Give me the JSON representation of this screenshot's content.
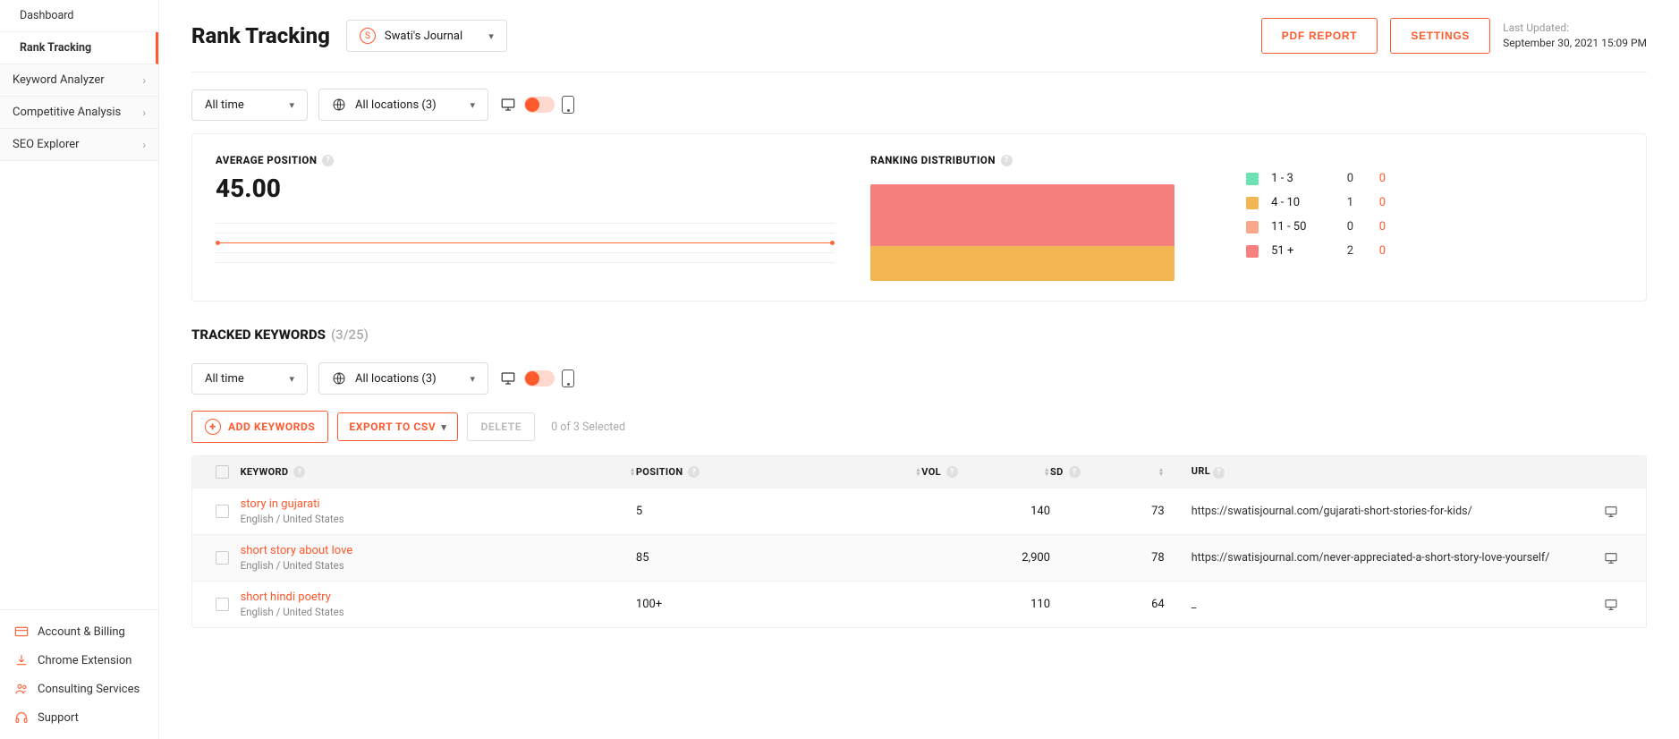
{
  "sidebar": {
    "dashboard": "Dashboard",
    "rankTracking": "Rank Tracking",
    "keywordAnalyzer": "Keyword Analyzer",
    "competitiveAnalysis": "Competitive Analysis",
    "seoExplorer": "SEO Explorer"
  },
  "sidebarBottom": {
    "accountBilling": "Account & Billing",
    "chromeExtension": "Chrome Extension",
    "consultingServices": "Consulting Services",
    "support": "Support"
  },
  "header": {
    "title": "Rank Tracking",
    "accountAvatar": "S",
    "accountName": "Swati's Journal",
    "pdfReport": "PDF REPORT",
    "settings": "SETTINGS",
    "lastUpdatedLabel": "Last Updated:",
    "lastUpdatedValue": "September 30, 2021 15:09 PM"
  },
  "filters": {
    "timeRange": "All time",
    "locations": "All locations (3)"
  },
  "avgPosition": {
    "label": "AVERAGE POSITION",
    "value": "45.00"
  },
  "rankingDistribution": {
    "label": "RANKING DISTRIBUTION",
    "legend": [
      {
        "range": "1 - 3",
        "col1": "0",
        "col2": "0",
        "color": "#6de2b5"
      },
      {
        "range": "4 - 10",
        "col1": "1",
        "col2": "0",
        "color": "#f2b752"
      },
      {
        "range": "11 - 50",
        "col1": "0",
        "col2": "0",
        "color": "#f9a98a"
      },
      {
        "range": "51 +",
        "col1": "2",
        "col2": "0",
        "color": "#f5807e"
      }
    ]
  },
  "trackedKeywords": {
    "label": "TRACKED KEYWORDS",
    "count": "(3/25)"
  },
  "actions": {
    "addKeywords": "ADD KEYWORDS",
    "exportCsv": "EXPORT TO CSV",
    "delete": "DELETE",
    "selectedText": "0 of 3 Selected"
  },
  "table": {
    "headers": {
      "keyword": "KEYWORD",
      "position": "POSITION",
      "vol": "VOL",
      "sd": "SD",
      "url": "URL"
    },
    "rows": [
      {
        "keyword": "story in gujarati",
        "locale": "English / United States",
        "position": "5",
        "vol": "140",
        "sd": "73",
        "url": "https://swatisjournal.com/gujarati-short-stories-for-kids/"
      },
      {
        "keyword": "short story about love",
        "locale": "English / United States",
        "position": "85",
        "vol": "2,900",
        "sd": "78",
        "url": "https://swatisjournal.com/never-appreciated-a-short-story-love-yourself/"
      },
      {
        "keyword": "short hindi poetry",
        "locale": "English / United States",
        "position": "100+",
        "vol": "110",
        "sd": "64",
        "url": "_"
      }
    ]
  },
  "chart_data": {
    "type": "bar",
    "title": "Ranking Distribution",
    "categories": [
      "1 - 3",
      "4 - 10",
      "11 - 50",
      "51 +"
    ],
    "values": [
      0,
      1,
      0,
      2
    ]
  }
}
